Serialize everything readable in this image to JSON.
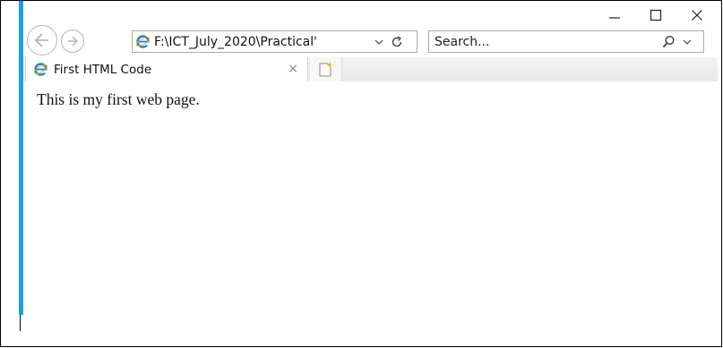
{
  "window": {
    "minimize_glyph": "—",
    "maximize_glyph": "☐",
    "close_glyph": "✕"
  },
  "nav": {
    "address": "F:\\ICT_July_2020\\Practical'",
    "search_placeholder": "Search..."
  },
  "tabs": [
    {
      "title": "First HTML Code",
      "close_glyph": "×"
    }
  ],
  "page": {
    "body_text": "This is my first web page."
  },
  "colors": {
    "accent": "#1ba1e2",
    "ie_logo": "#1e88d6"
  },
  "icons": {
    "back": "back-arrow-icon",
    "forward": "forward-arrow-icon",
    "site": "ie-logo-icon",
    "dropdown": "chevron-down-icon",
    "refresh": "refresh-icon",
    "search": "search-icon",
    "new_tab": "new-tab-icon"
  }
}
